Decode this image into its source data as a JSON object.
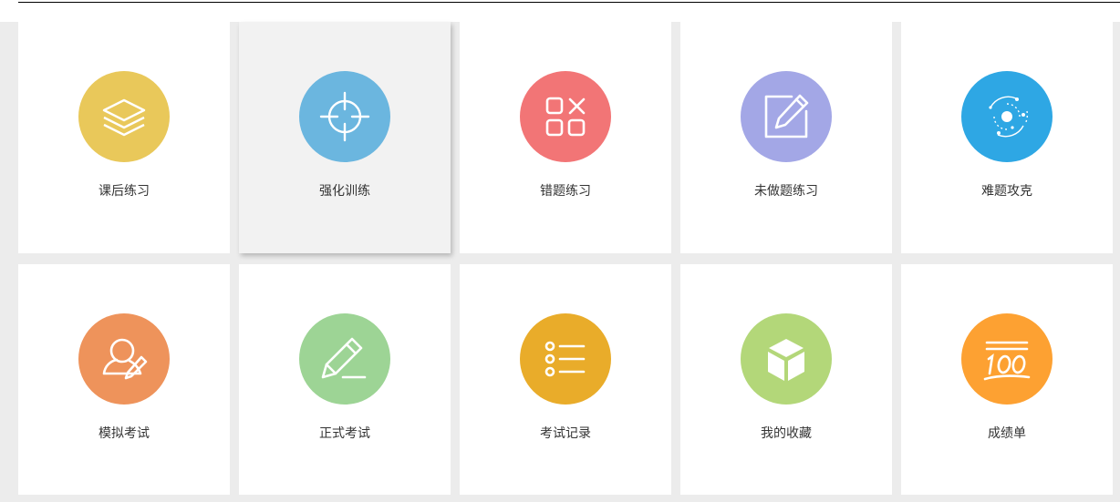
{
  "menu": {
    "tiles": [
      {
        "label": "课后练习",
        "icon": "layers-icon",
        "color": "#e9c85a"
      },
      {
        "label": "强化训练",
        "icon": "crosshair-icon",
        "color": "#6bb6df"
      },
      {
        "label": "错题练习",
        "icon": "grid-x-icon",
        "color": "#f27576"
      },
      {
        "label": "未做题练习",
        "icon": "edit-square-icon",
        "color": "#a3a7e6"
      },
      {
        "label": "难题攻克",
        "icon": "orbit-icon",
        "color": "#2ea7e4"
      },
      {
        "label": "模拟考试",
        "icon": "user-edit-icon",
        "color": "#ee935b"
      },
      {
        "label": "正式考试",
        "icon": "pencil-icon",
        "color": "#9dd495"
      },
      {
        "label": "考试记录",
        "icon": "list-icon",
        "color": "#e9ac2a"
      },
      {
        "label": "我的收藏",
        "icon": "cube-icon",
        "color": "#b3d779"
      },
      {
        "label": "成绩单",
        "icon": "score-100-icon",
        "color": "#fda132"
      }
    ]
  }
}
